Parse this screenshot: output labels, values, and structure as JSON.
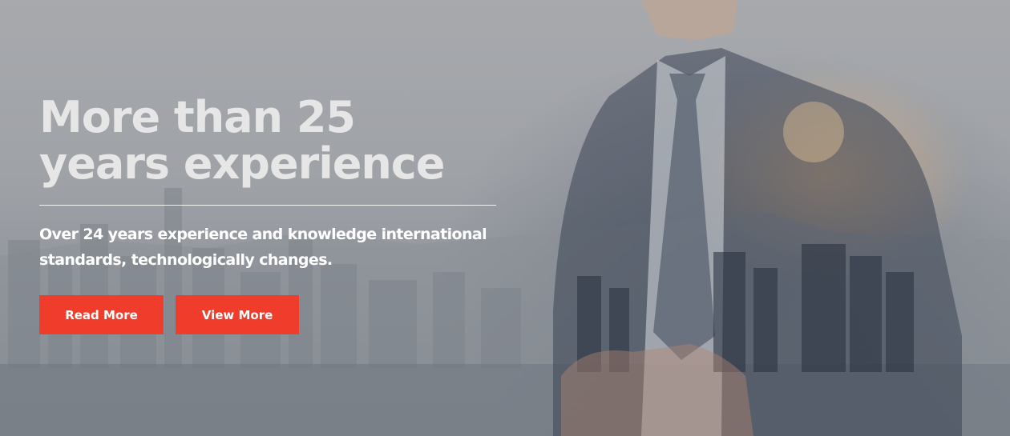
{
  "hero": {
    "title": "More than 25 years experience",
    "subtitle": "Over 24 years experience and knowledge international standards, technologically changes.",
    "buttons": {
      "read_more": "Read More",
      "view_more": "View More"
    }
  },
  "colors": {
    "accent": "#f03c2a",
    "title_text": "#e6e6e6",
    "subtitle_text": "#ffffff"
  }
}
